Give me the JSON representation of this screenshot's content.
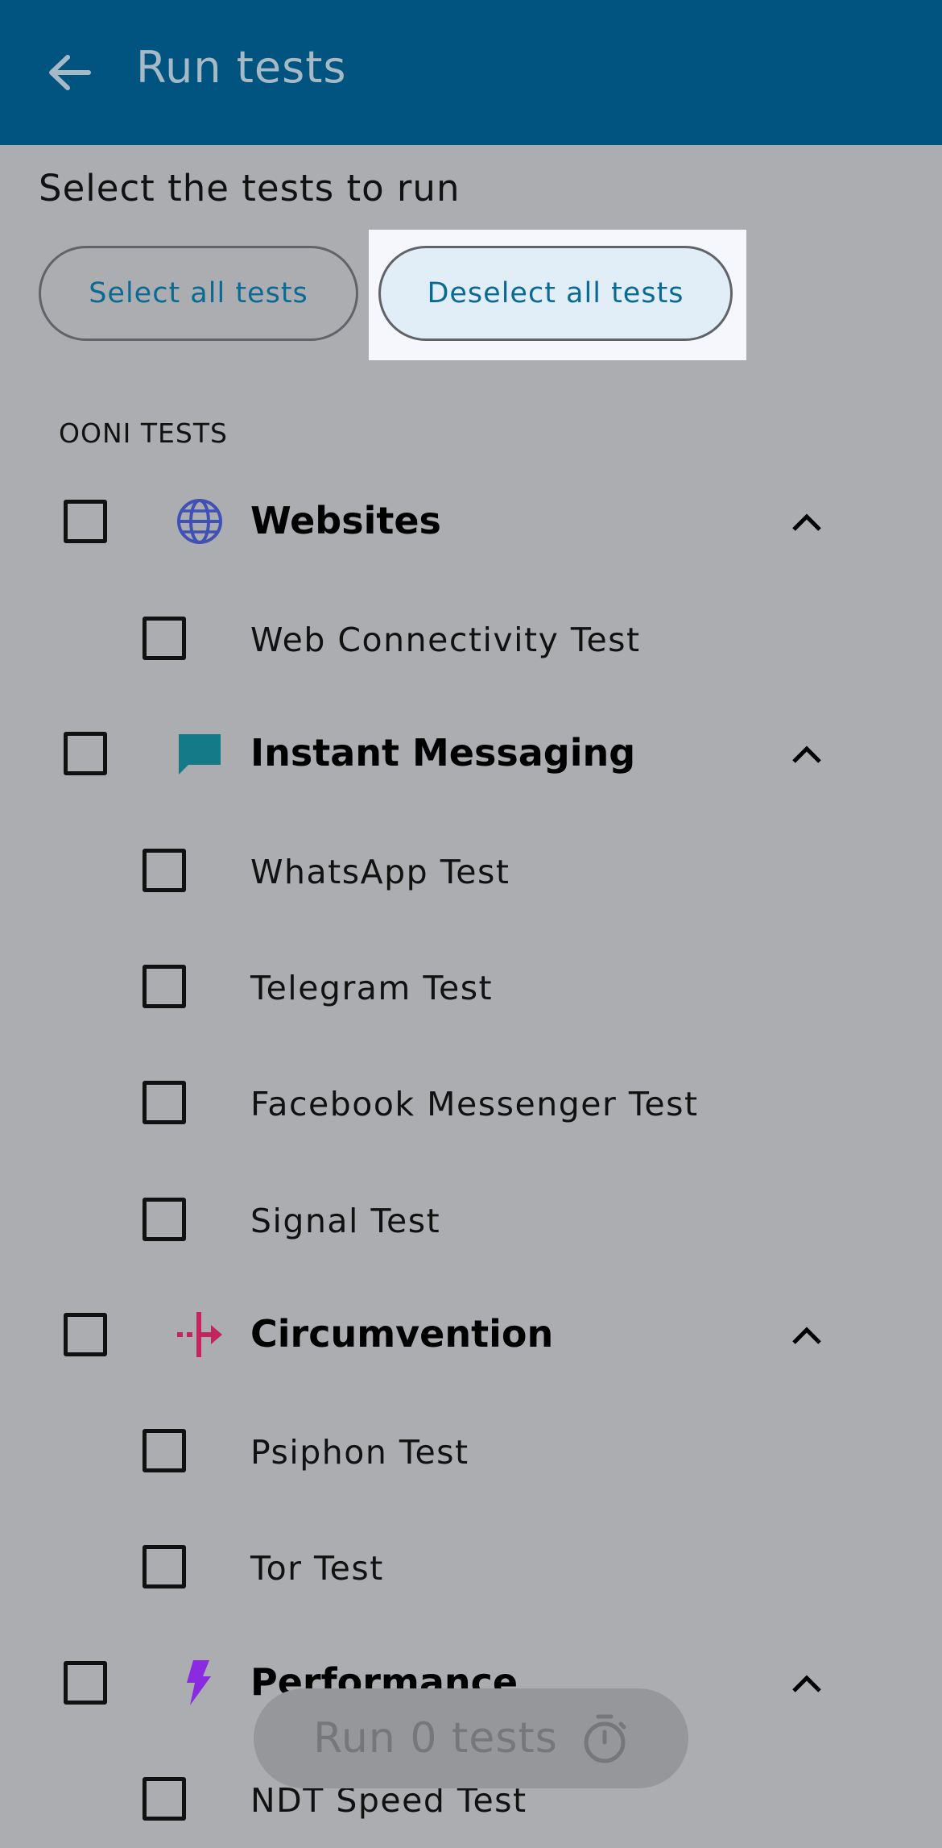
{
  "app_bar": {
    "title": "Run tests",
    "back_icon": "arrow-left-icon"
  },
  "subtitle": "Select the tests to run",
  "buttons": {
    "select_all": "Select all tests",
    "deselect_all": "Deselect all tests"
  },
  "section_label": "OONI TESTS",
  "categories": [
    {
      "label": "Websites",
      "icon": "globe-icon",
      "color": "#3f51b5",
      "checked": false,
      "expanded": true,
      "tests": [
        {
          "label": "Web Connectivity Test",
          "checked": false
        }
      ]
    },
    {
      "label": "Instant Messaging",
      "icon": "chat-bubble-icon",
      "color": "#157a87",
      "checked": false,
      "expanded": true,
      "tests": [
        {
          "label": "WhatsApp Test",
          "checked": false
        },
        {
          "label": "Telegram Test",
          "checked": false
        },
        {
          "label": "Facebook Messenger Test",
          "checked": false
        },
        {
          "label": "Signal Test",
          "checked": false
        }
      ]
    },
    {
      "label": "Circumvention",
      "icon": "circumvention-icon",
      "color": "#c2255c",
      "checked": false,
      "expanded": true,
      "tests": [
        {
          "label": "Psiphon Test",
          "checked": false
        },
        {
          "label": "Tor Test",
          "checked": false
        }
      ]
    },
    {
      "label": "Performance",
      "icon": "lightning-bolt-icon",
      "color": "#8a2be2",
      "checked": false,
      "expanded": true,
      "tests": [
        {
          "label": "NDT Speed Test",
          "checked": false
        }
      ]
    }
  ],
  "run_button": {
    "label": "Run 0 tests",
    "icon": "timer-icon"
  },
  "colors": {
    "app_bar": "#00547f",
    "background": "#acadb0",
    "accent_text": "#0b6a93"
  }
}
